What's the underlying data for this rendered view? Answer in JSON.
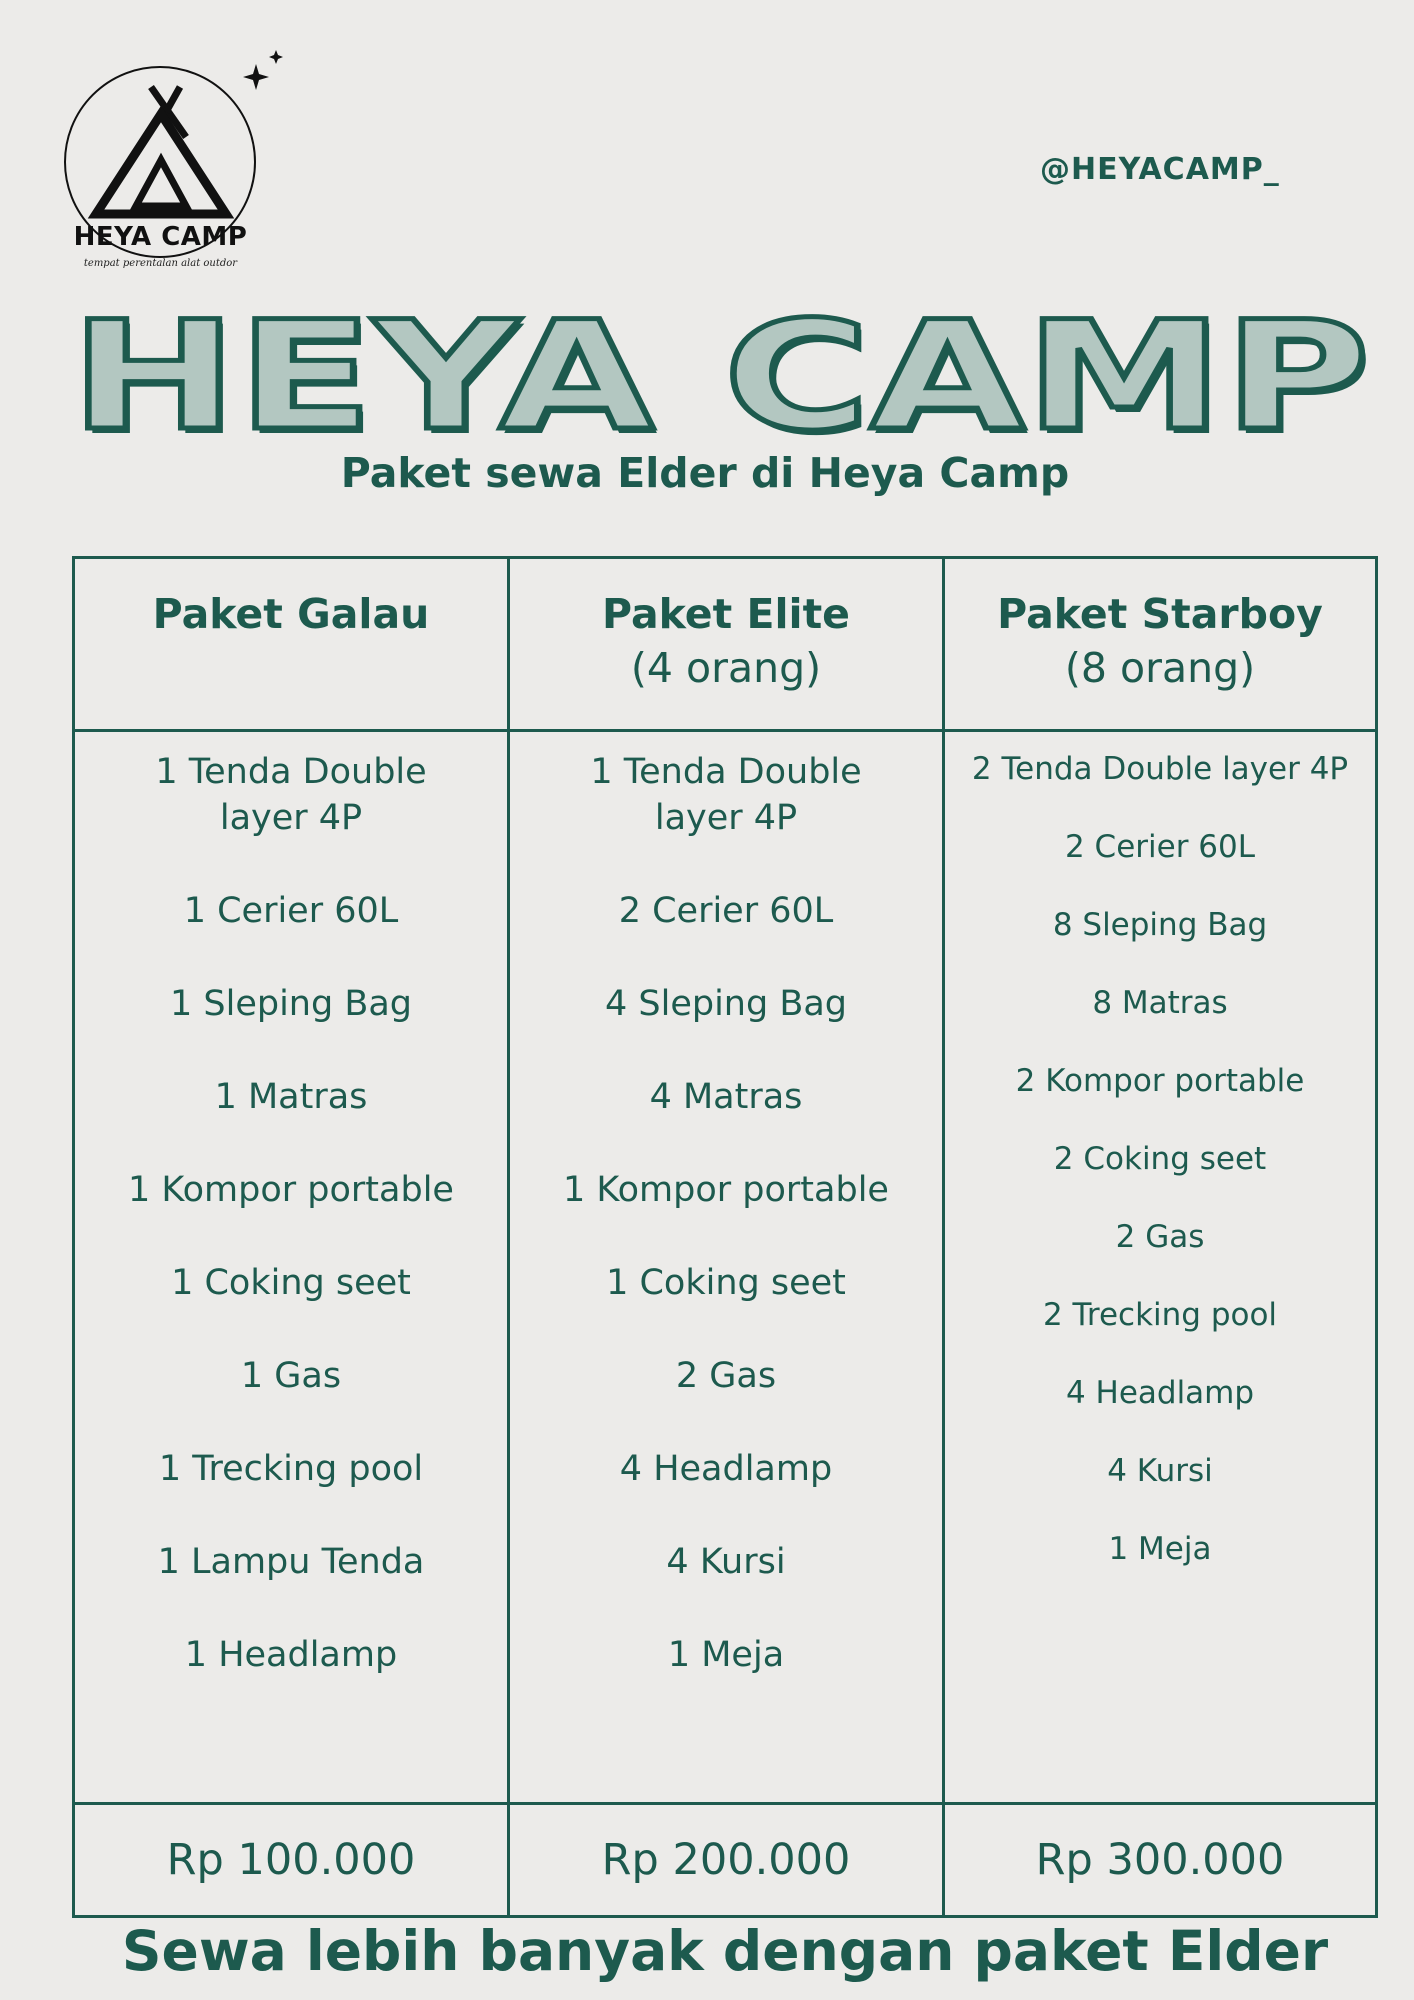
{
  "brand": {
    "logo_name": "HEYA CAMP",
    "logo_tagline": "tempat perentalan alat outdor",
    "handle": "@HEYACAMP_"
  },
  "title": "HEYA CAMP",
  "subtitle": "Paket sewa Elder di Heya Camp",
  "colors": {
    "primary": "#1d5a4e",
    "title_fill": "#b3c7c1",
    "background": "#ecebe9"
  },
  "packages": [
    {
      "name": "Paket Galau",
      "people": "",
      "items": [
        "1 Tenda Double layer 4P",
        "1 Cerier 60L",
        "1 Sleping Bag",
        "1 Matras",
        "1 Kompor portable",
        "1 Coking seet",
        "1 Gas",
        "1 Trecking pool",
        "1 Lampu Tenda",
        "1 Headlamp"
      ],
      "price": "Rp 100.000"
    },
    {
      "name": "Paket Elite",
      "people": "(4 orang)",
      "items": [
        "1 Tenda Double layer 4P",
        "2 Cerier 60L",
        "4 Sleping Bag",
        "4 Matras",
        "1 Kompor portable",
        "1 Coking seet",
        "2 Gas",
        "4 Headlamp",
        "4 Kursi",
        "1 Meja"
      ],
      "price": "Rp 200.000"
    },
    {
      "name": "Paket Starboy",
      "people": "(8 orang)",
      "items": [
        "2 Tenda Double layer 4P",
        "2 Cerier 60L",
        "8 Sleping Bag",
        "8 Matras",
        "2 Kompor portable",
        "2 Coking seet",
        "2 Gas",
        "2 Trecking pool",
        "4 Headlamp",
        "4 Kursi",
        "1 Meja"
      ],
      "price": "Rp 300.000"
    }
  ],
  "footer": "Sewa lebih banyak dengan paket Elder"
}
